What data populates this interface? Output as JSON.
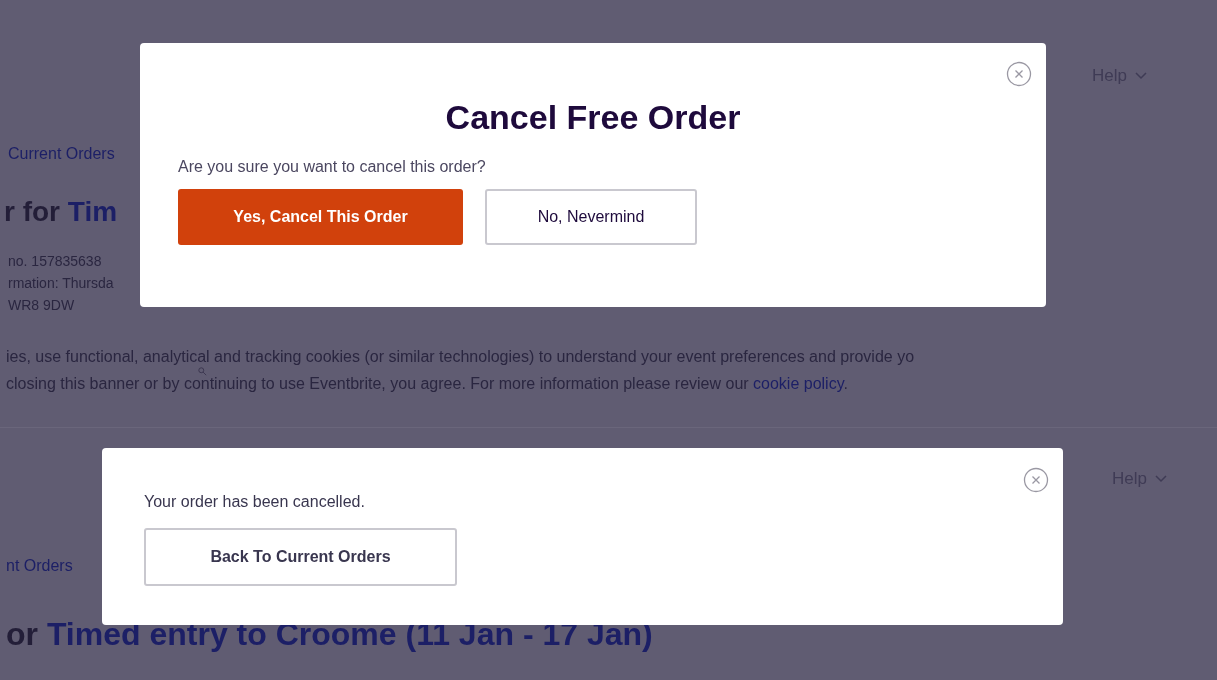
{
  "background_top": {
    "help_menu": "Help",
    "breadcrumb": "Current Orders",
    "heading": {
      "prefix": "r for ",
      "event": "Tim"
    },
    "order_number": "no. 157835638",
    "information": "rmation: Thursda",
    "postcode": "WR8 9DW",
    "cookie_notice": {
      "line_1": "ies, use functional, analytical and tracking cookies (or similar technologies) to understand your event preferences and provide yo",
      "line_2": "closing this banner or by continuing to use Eventbrite, you agree. For more information please review our ",
      "link": "cookie policy",
      "line_2_end": "."
    }
  },
  "background_bottom": {
    "help_menu": "Help",
    "breadcrumb": "nt Orders",
    "heading": {
      "prefix": "or ",
      "event": "Timed entry to Croome (11 Jan - 17 Jan)"
    }
  },
  "cancel_dialog": {
    "title": "Cancel Free Order",
    "message": "Are you sure you want to cancel this order?",
    "confirm_button": "Yes, Cancel This Order",
    "dismiss_button": "No, Nevermind"
  },
  "confirmation_dialog": {
    "message": "Your order has been cancelled.",
    "button": "Back To Current Orders"
  }
}
